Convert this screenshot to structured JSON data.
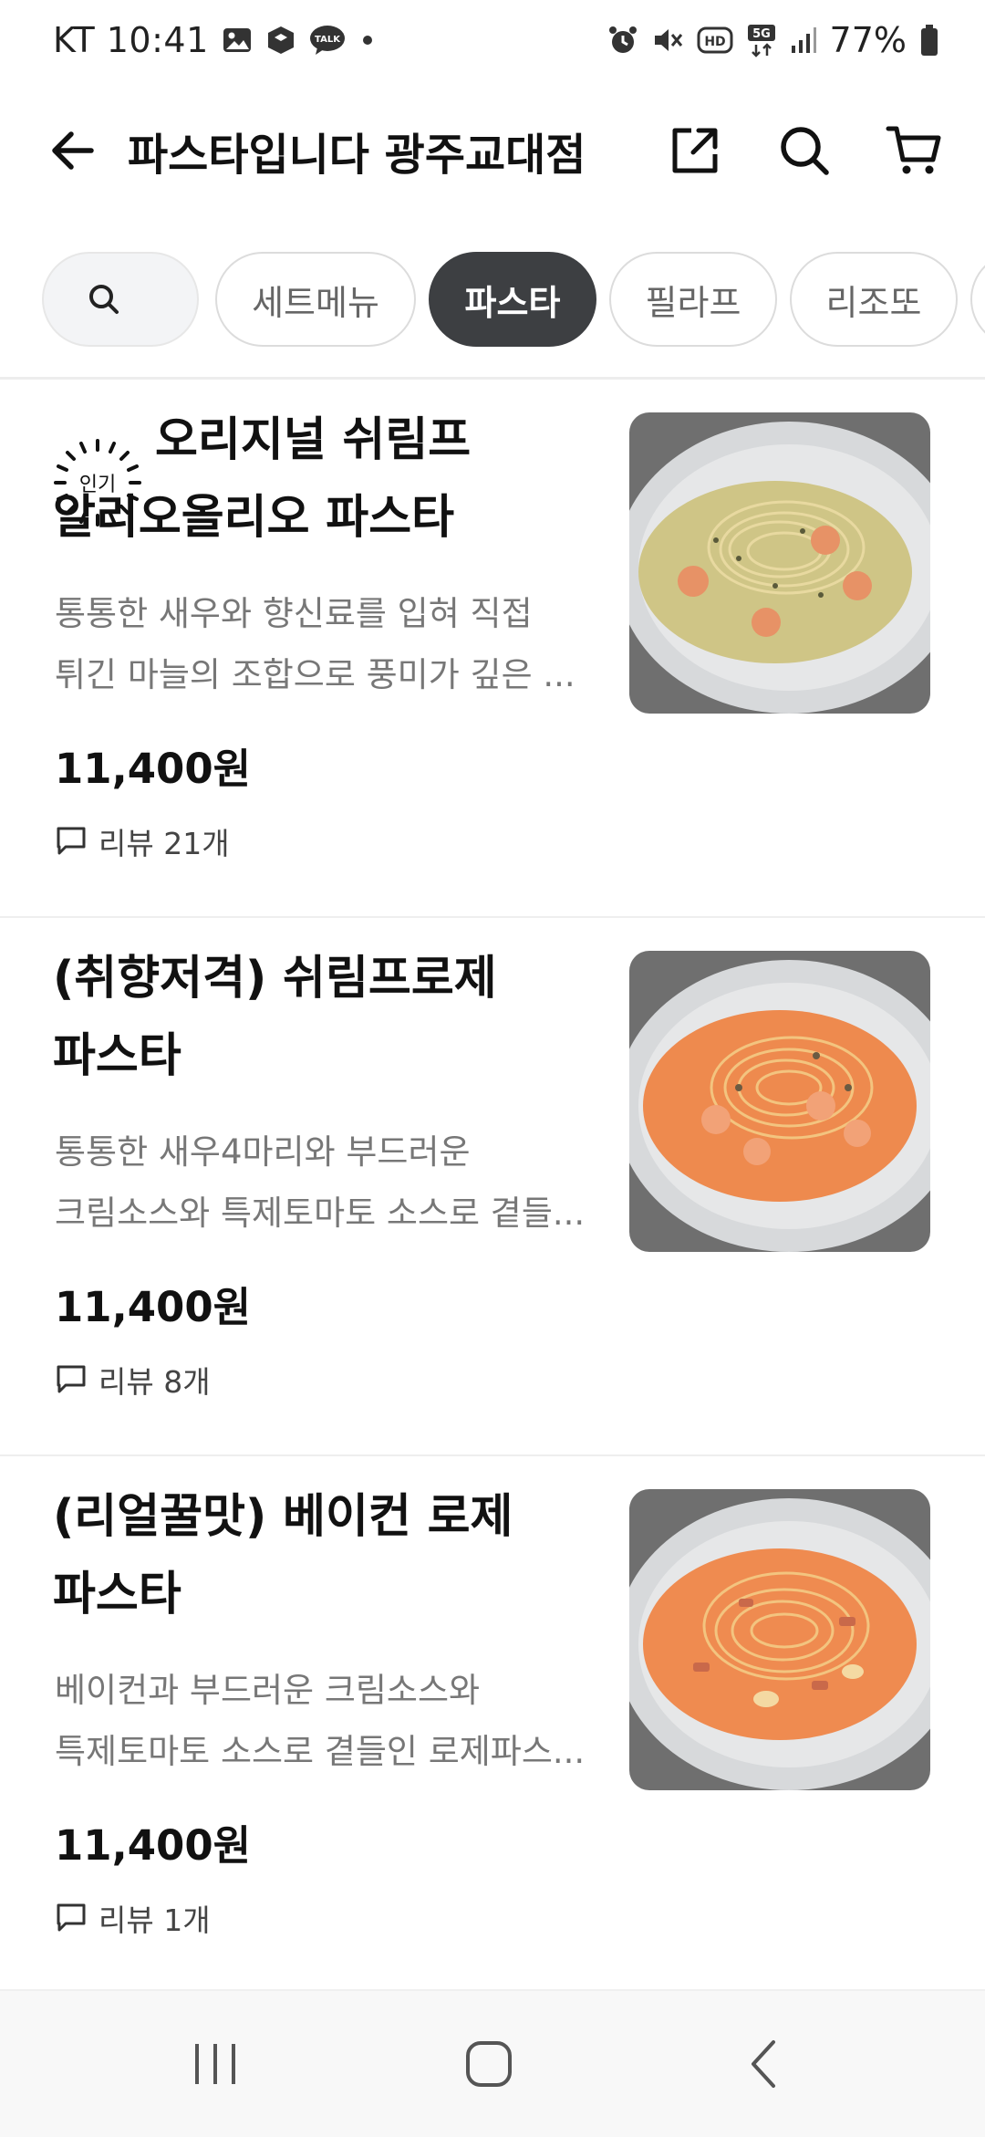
{
  "status_bar": {
    "carrier_time": "KT 10:41",
    "talk_label": "TALK",
    "hd_label": "HD",
    "network_label": "5G",
    "battery_percent": "77%"
  },
  "header": {
    "title": "파스타입니다 광주교대점"
  },
  "categories": [
    {
      "label": "세트메뉴"
    },
    {
      "label": "파스타",
      "active": true
    },
    {
      "label": "필라프"
    },
    {
      "label": "리조또"
    }
  ],
  "menu_items": [
    {
      "badge": "인기",
      "name_line1": "오리지널 쉬림프",
      "name_line2": "알리오올리오 파스타",
      "desc_line1": "통통한 새우와 향신료를 입혀 직접",
      "desc_line2": "튀긴 마늘의 조합으로 풍미가 깊은 ...",
      "price": "11,400원",
      "reviews": "리뷰 21개",
      "sauce_color": "#cfc586"
    },
    {
      "name_line1": "(취향저격) 쉬림프로제",
      "name_line2": "파스타",
      "desc_line1": "통통한 새우4마리와 부드러운",
      "desc_line2": "크림소스와 특제토마토 소스로 곁들...",
      "price": "11,400원",
      "reviews": "리뷰 8개",
      "sauce_color": "#ee8a4e"
    },
    {
      "name_line1": "(리얼꿀맛) 베이컨 로제",
      "name_line2": "파스타",
      "desc_line1": "베이컨과 부드러운 크림소스와",
      "desc_line2": "특제토마토 소스로 곁들인 로제파스...",
      "price": "11,400원",
      "reviews": "리뷰 1개",
      "sauce_color": "#ef8b50"
    }
  ],
  "colors": {
    "chip_active_bg": "#3d3f42",
    "text_primary": "#111111",
    "text_secondary": "#777777"
  },
  "icons": [
    "gallery-icon",
    "box-icon",
    "talk-icon",
    "alarm-icon",
    "mute-icon",
    "signal-icon",
    "battery-icon",
    "back-arrow-icon",
    "share-icon",
    "search-icon",
    "cart-icon",
    "review-bubble-icon",
    "recent-apps-icon",
    "home-icon",
    "nav-back-icon"
  ]
}
